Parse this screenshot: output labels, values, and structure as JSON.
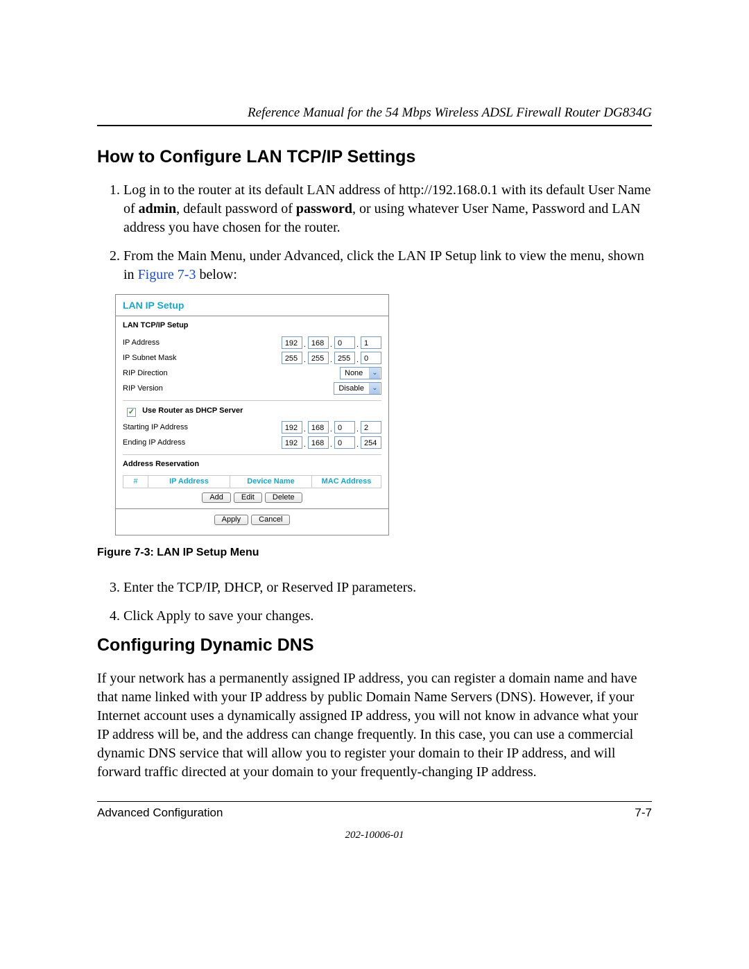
{
  "header": {
    "running_title": "Reference Manual for the 54 Mbps Wireless ADSL Firewall Router DG834G"
  },
  "section1": {
    "heading": "How to Configure LAN TCP/IP Settings",
    "step1_a": "Log in to the router at its default LAN address of http://192.168.0.1 with its default User Name of ",
    "step1_admin": "admin",
    "step1_b": ", default password of ",
    "step1_password": "password",
    "step1_c": ", or using whatever User Name, Password and LAN address you have chosen for the router.",
    "step2_a": "From the Main Menu, under Advanced, click the LAN IP Setup link to view the menu, shown in ",
    "step2_link": "Figure 7-3",
    "step2_b": " below:"
  },
  "figure": {
    "panel_title": "LAN IP Setup",
    "sub_tcpip": "LAN TCP/IP Setup",
    "lbl_ip": "IP Address",
    "lbl_mask": "IP Subnet Mask",
    "lbl_ripdir": "RIP Direction",
    "lbl_ripver": "RIP Version",
    "ip": [
      "192",
      "168",
      "0",
      "1"
    ],
    "mask": [
      "255",
      "255",
      "255",
      "0"
    ],
    "rip_dir": "None",
    "rip_ver": "Disable",
    "dhcp_label": "Use Router as DHCP Server",
    "lbl_start": "Starting IP Address",
    "lbl_end": "Ending IP Address",
    "start_ip": [
      "192",
      "168",
      "0",
      "2"
    ],
    "end_ip": [
      "192",
      "168",
      "0",
      "254"
    ],
    "sub_addr": "Address Reservation",
    "th1": "#",
    "th2": "IP Address",
    "th3": "Device Name",
    "th4": "MAC Address",
    "btn_add": "Add",
    "btn_edit": "Edit",
    "btn_delete": "Delete",
    "btn_apply": "Apply",
    "btn_cancel": "Cancel",
    "caption": "Figure 7-3:  LAN IP Setup Menu"
  },
  "section1b": {
    "step3": "Enter the TCP/IP, DHCP, or Reserved IP parameters.",
    "step4": "Click Apply to save your changes."
  },
  "section2": {
    "heading": "Configuring Dynamic DNS",
    "para": "If your network has a permanently assigned IP address, you can register a domain name and have that name linked with your IP address by public Domain Name Servers (DNS). However, if your Internet account uses a dynamically assigned IP address, you will not know in advance what your IP address will be, and the address can change frequently. In this case, you can use a commercial dynamic DNS service that will allow you to register your domain to their IP address, and will forward traffic directed at your domain to your frequently-changing IP address."
  },
  "footer": {
    "left": "Advanced Configuration",
    "right": "7-7",
    "docnum": "202-10006-01"
  }
}
